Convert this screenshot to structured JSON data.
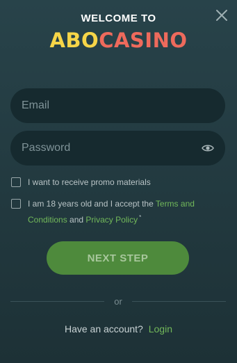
{
  "header": {
    "welcome": "WELCOME TO",
    "logo_part1": "ABO",
    "logo_part2": "CASINO"
  },
  "form": {
    "email_placeholder": "Email",
    "password_placeholder": "Password"
  },
  "checks": {
    "promo_label": "I want to receive promo materials",
    "terms_prefix": "I am 18 years old and I accept the ",
    "terms_link": "Terms and Conditions",
    "and_text": " and ",
    "privacy_link": "Privacy Policy",
    "required_mark": "*"
  },
  "actions": {
    "next_label": "NEXT STEP",
    "or_text": "or",
    "have_account": "Have an account?",
    "login_link": "Login"
  },
  "colors": {
    "background": "#22393f",
    "field_bg": "#162a2f",
    "logo_yellow": "#f6d548",
    "logo_red": "#ee6a5c",
    "accent_green": "#72b85a",
    "button_green": "#4e8a3c"
  },
  "icons": [
    "close-icon",
    "eye-icon"
  ]
}
